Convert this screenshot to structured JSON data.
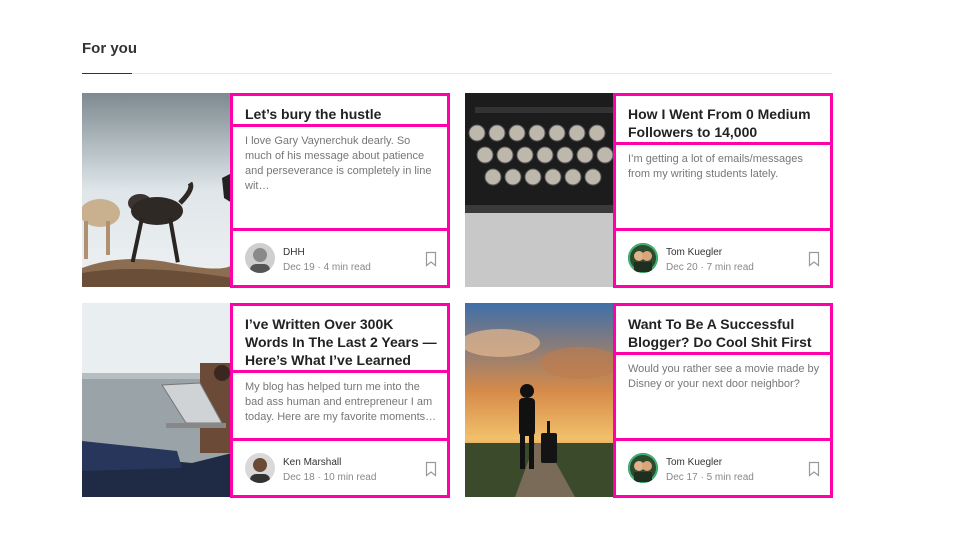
{
  "section": {
    "title": "For you"
  },
  "articles": [
    {
      "title": "Let’s bury the hustle",
      "description": "I love Gary Vaynerchuk dearly. So much of his message about patience and perseverance is completely in line wit…",
      "author": "DHH",
      "date": "Dec 19",
      "read_time": "4 min read",
      "image": "dogs-fighting-photo",
      "avatar": "dhh-avatar"
    },
    {
      "title": "How I Went From 0 Medium Followers to 14,000",
      "description": "I’m getting a lot of emails/messages from my writing students lately.",
      "author": "Tom Kuegler",
      "date": "Dec 20",
      "read_time": "7 min read",
      "image": "typewriter-keys-photo",
      "avatar": "tom-kuegler-avatar"
    },
    {
      "title": "I’ve Written Over 300K Words In The Last 2 Years — Here’s What I’ve Learned",
      "description": "My blog has helped turn me into the bad ass human and entrepreneur I am today. Here are my favorite moments…",
      "author": "Ken Marshall",
      "date": "Dec 18",
      "read_time": "10 min read",
      "image": "person-with-laptop-photo",
      "avatar": "ken-marshall-avatar"
    },
    {
      "title": "Want To Be A Successful Blogger? Do Cool Shit First",
      "description": "Would you rather see a movie made by Disney or your next door neighbor?",
      "author": "Tom Kuegler",
      "date": "Dec 17",
      "read_time": "5 min read",
      "image": "traveler-with-suitcase-sunset-photo",
      "avatar": "tom-kuegler-avatar"
    }
  ],
  "separator": "·",
  "colors": {
    "highlight": "#ff00ab",
    "text_title": "#222222",
    "text_desc": "#777777"
  }
}
